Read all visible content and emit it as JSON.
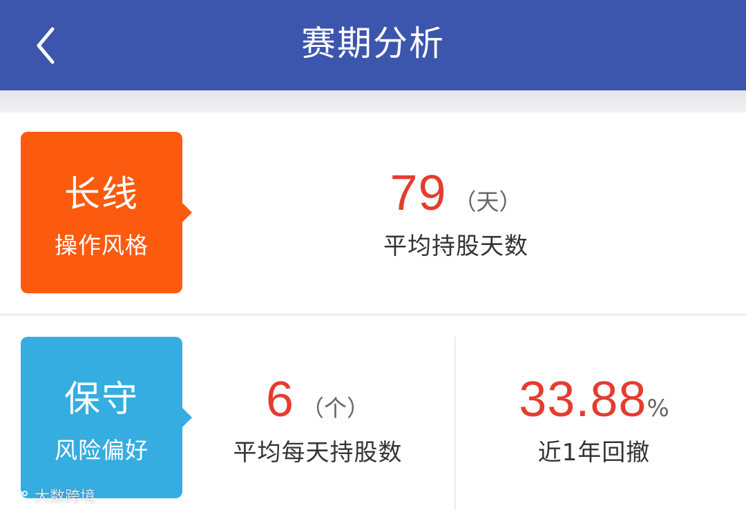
{
  "header": {
    "title": "赛期分析",
    "back_icon": "chevron-left-icon",
    "background": "#3c55ad"
  },
  "style": {
    "tag": {
      "label": "长线",
      "sublabel": "操作风格",
      "color": "#fc5a0f"
    },
    "avg_holding_days": {
      "value": "79",
      "unit": "（天）",
      "label": "平均持股天数"
    }
  },
  "risk": {
    "tag": {
      "label": "保守",
      "sublabel": "风险偏好",
      "color": "#36ade1"
    },
    "avg_daily_holdings": {
      "value": "6",
      "unit": "（个）",
      "label": "平均每天持股数"
    },
    "drawdown_1y": {
      "value": "33.88",
      "unit": "%",
      "label": "近1年回撤"
    }
  },
  "accent_number_color": "#e53c2f",
  "watermark": {
    "text": "大数跨境",
    "icon": "watermark-logo-icon"
  }
}
